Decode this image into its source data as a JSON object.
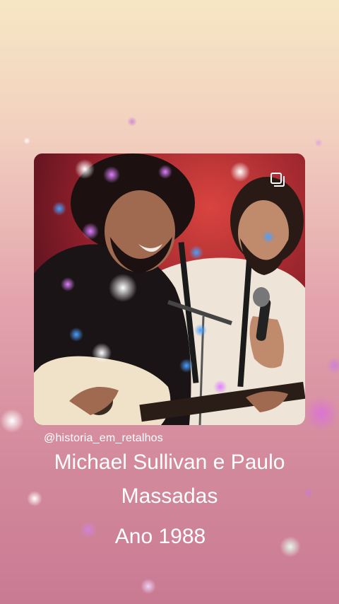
{
  "post": {
    "handle": "@historia_em_retalhos",
    "title_line1": "Michael Sullivan e Paulo",
    "title_line2": "Massadas",
    "year": "Ano 1988"
  },
  "photo": {
    "description_icon": "copy-icon"
  },
  "colors": {
    "text": "#ffffff",
    "background_top": "#f6e7c4",
    "background_bottom": "#c97a93",
    "photo_bg": "#8e1f2a"
  }
}
